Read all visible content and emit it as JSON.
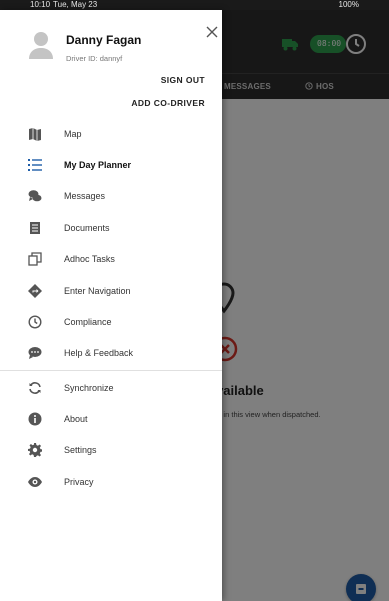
{
  "status_bar": {
    "time": "10:10",
    "date": "Tue, May 23",
    "battery": "100%"
  },
  "background_app": {
    "timer": "08:00",
    "tabs": [
      "MESSAGES",
      "HOS"
    ],
    "empty_state": {
      "title": "s available",
      "subtitle": "appear in this view when dispatched."
    }
  },
  "drawer": {
    "user": {
      "name": "Danny Fagan",
      "driver_id": "Driver ID: dannyf"
    },
    "actions": {
      "sign_out": "SIGN OUT",
      "add_co_driver": "ADD CO-DRIVER"
    },
    "main_menu": [
      {
        "label": "Map",
        "icon": "map-icon",
        "active": false
      },
      {
        "label": "My Day Planner",
        "icon": "list-icon",
        "active": true
      },
      {
        "label": "Messages",
        "icon": "chat-bubbles-icon",
        "active": false
      },
      {
        "label": "Documents",
        "icon": "document-icon",
        "active": false
      },
      {
        "label": "Adhoc Tasks",
        "icon": "tasks-icon",
        "active": false
      },
      {
        "label": "Enter Navigation",
        "icon": "navigation-diamond-icon",
        "active": false
      },
      {
        "label": "Compliance",
        "icon": "clock-icon",
        "active": false
      },
      {
        "label": "Help & Feedback",
        "icon": "feedback-icon",
        "active": false
      }
    ],
    "secondary_menu": [
      {
        "label": "Synchronize",
        "icon": "sync-icon"
      },
      {
        "label": "About",
        "icon": "info-icon"
      },
      {
        "label": "Settings",
        "icon": "gear-icon"
      },
      {
        "label": "Privacy",
        "icon": "eye-icon"
      }
    ]
  },
  "colors": {
    "accent_active": "#1f5da8",
    "timer_green": "#2fa14f",
    "header_dark": "#2f2f2f",
    "error_red": "#d9342b",
    "icon_gray": "#555555"
  }
}
